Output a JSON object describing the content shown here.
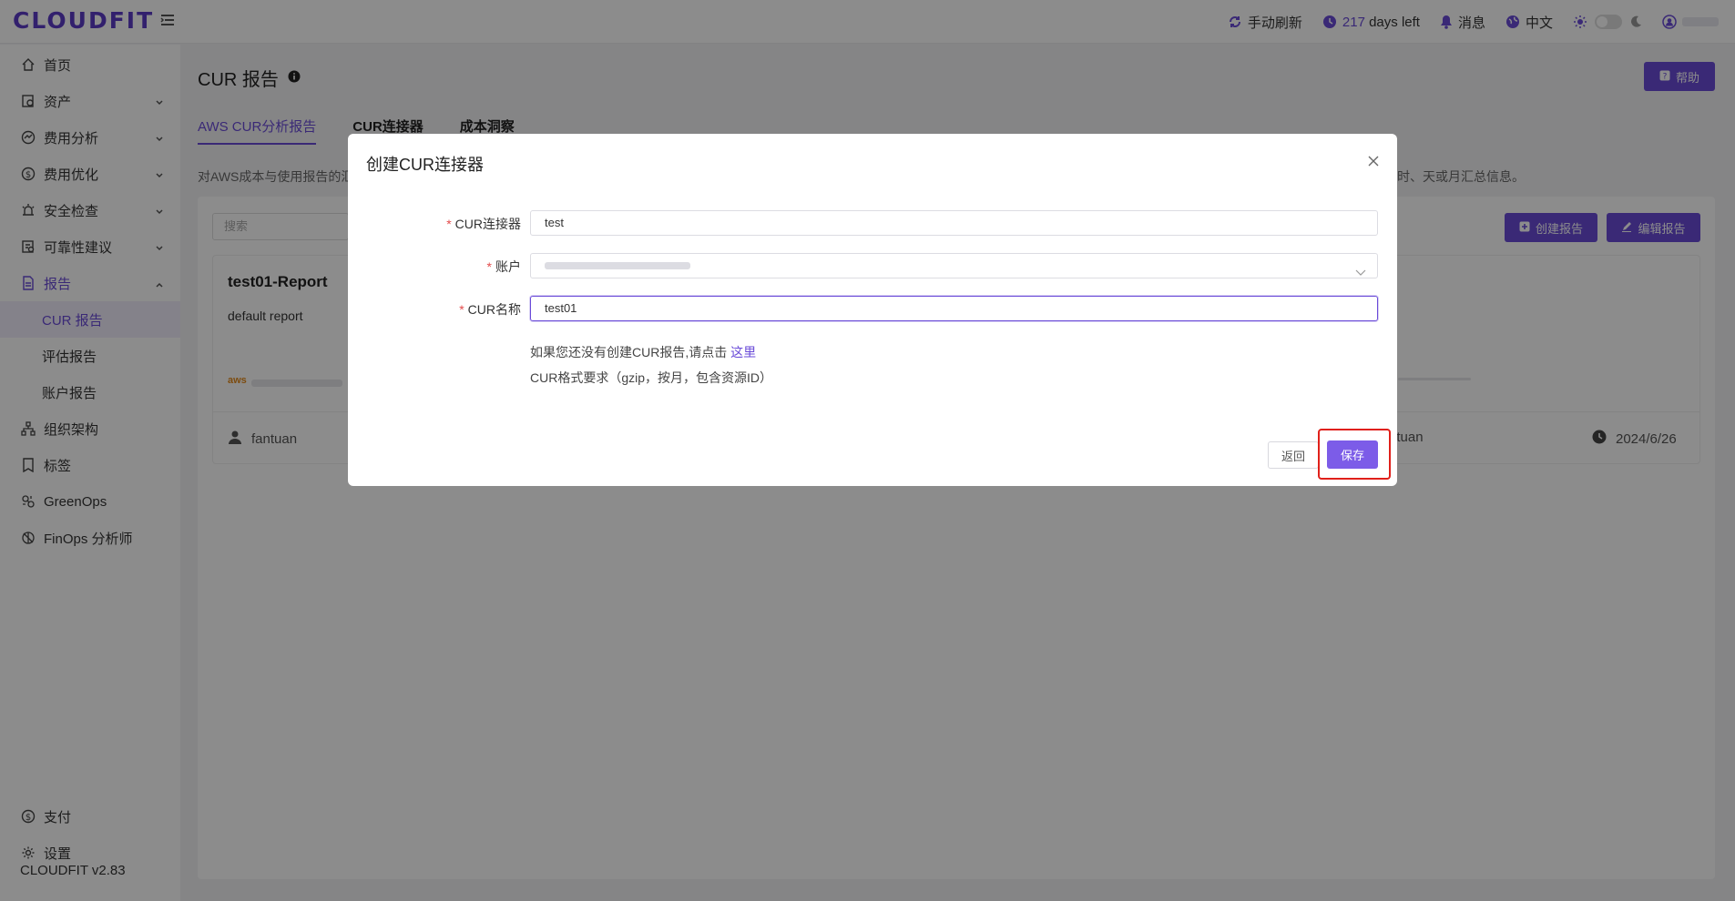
{
  "header": {
    "logo": "CLOUDFIT",
    "refresh_label": "手动刷新",
    "days_num": "217",
    "days_suffix": "days left",
    "messages_label": "消息",
    "language_label": "中文"
  },
  "sidebar": {
    "items": [
      {
        "label": "首页",
        "icon": "home-icon"
      },
      {
        "label": "资产",
        "icon": "asset-icon"
      },
      {
        "label": "费用分析",
        "icon": "cost-analysis-icon"
      },
      {
        "label": "费用优化",
        "icon": "dollar-icon"
      },
      {
        "label": "安全检查",
        "icon": "alarm-icon"
      },
      {
        "label": "可靠性建议",
        "icon": "reliability-icon"
      },
      {
        "label": "报告",
        "icon": "report-icon"
      },
      {
        "label": "CUR 报告"
      },
      {
        "label": "评估报告"
      },
      {
        "label": "账户报告"
      },
      {
        "label": "组织架构",
        "icon": "org-icon"
      },
      {
        "label": "标签",
        "icon": "tag-icon"
      },
      {
        "label": "GreenOps",
        "icon": "greenops-icon"
      },
      {
        "label": "FinOps 分析师",
        "icon": "finops-icon"
      },
      {
        "label": "支付",
        "icon": "payment-icon"
      },
      {
        "label": "设置",
        "icon": "gear-icon"
      }
    ],
    "version": "CLOUDFIT v2.83"
  },
  "page": {
    "title": "CUR 报告",
    "help_label": "帮助",
    "tabs": [
      "AWS CUR分析报告",
      "CUR连接器",
      "成本洞察"
    ],
    "desc_left": "对AWS成本与使用报告的汇",
    "desc_right": "时、天或月汇总信息。",
    "search_placeholder": "搜索",
    "create_report_label": "创建报告",
    "edit_report_label": "编辑报告",
    "report": {
      "title": "test01-Report",
      "desc": "default report",
      "owner": "fantuan",
      "owner_right": "ntuan",
      "date": "2024/6/26"
    }
  },
  "modal": {
    "title": "创建CUR连接器",
    "fields": {
      "connector_label": "CUR连接器",
      "connector_value": "test",
      "account_label": "账户",
      "curname_label": "CUR名称",
      "curname_value": "test01"
    },
    "hint_prefix": "如果您还没有创建CUR报告,请点击",
    "hint_link": "这里",
    "format_hint": "CUR格式要求（gzip，按月，包含资源ID）",
    "back_label": "返回",
    "save_label": "保存"
  },
  "colors": {
    "accent": "#6a4bd8",
    "highlight": "#e0201a"
  }
}
